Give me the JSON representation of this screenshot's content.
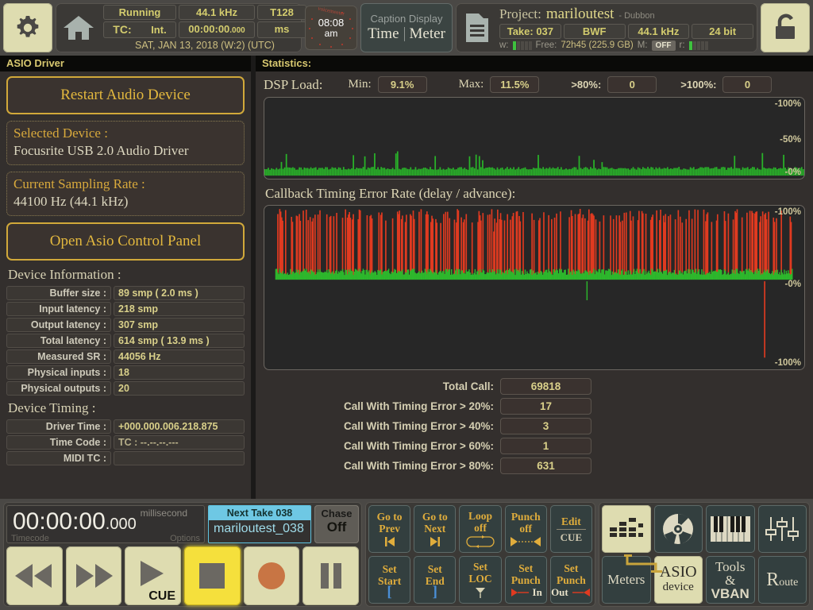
{
  "header": {
    "settings_icon": "gear-icon",
    "home_icon": "home-icon",
    "status": {
      "running": "Running",
      "samplerate": "44.1 kHz",
      "buffer": "T128",
      "tc_label": "TC:",
      "tc_source": "Int.",
      "timecode": "00:00:00",
      "timecode_ms": ".000",
      "units": "ms",
      "date": "SAT, JAN 13, 2018 (W:2) (UTC)"
    },
    "clock": {
      "time": "08:08",
      "ampm": "am",
      "brand": "voicemeeter"
    },
    "caption": {
      "title": "Caption Display",
      "opt_time": "Time",
      "opt_meter": "Meter"
    },
    "project": {
      "folder_icon": "folder-icon",
      "label": "Project:",
      "name": "mariloutest",
      "author": "- Dubbon",
      "take": "Take: 037",
      "format": "BWF",
      "samplerate": "44.1 kHz",
      "bitdepth": "24 bit",
      "write_label": "w:",
      "free_label": "Free:",
      "free_value": "72h45 (225.9 GB)",
      "monitor_label": "M:",
      "monitor_state": "OFF",
      "read_label": "r:",
      "write_level": 1,
      "read_level": 1
    },
    "lock_icon": "unlock-icon"
  },
  "left_panel": {
    "title": "ASIO Driver",
    "restart_button": "Restart Audio Device",
    "selected_device": {
      "label": "Selected Device :",
      "value": "Focusrite USB 2.0 Audio Driver"
    },
    "sampling_rate": {
      "label": "Current Sampling Rate :",
      "value": "44100 Hz (44.1 kHz)"
    },
    "control_panel_button": "Open Asio Control Panel",
    "device_info_title": "Device Information :",
    "device_info": [
      {
        "key": "Buffer size :",
        "value": "89 smp ( 2.0 ms )"
      },
      {
        "key": "Input latency :",
        "value": "218 smp"
      },
      {
        "key": "Output latency :",
        "value": "307 smp"
      },
      {
        "key": "Total latency :",
        "value": "614 smp ( 13.9 ms )"
      },
      {
        "key": "Measured SR :",
        "value": "44056 Hz"
      },
      {
        "key": "Physical inputs :",
        "value": "18"
      },
      {
        "key": "Physical outputs :",
        "value": "20"
      }
    ],
    "device_timing_title": "Device Timing :",
    "device_timing": [
      {
        "key": "Driver Time :",
        "value": "+000.000.006.218.875"
      },
      {
        "key": "Time Code :",
        "value": "TC : --.--.--.---"
      },
      {
        "key": "MIDI TC :",
        "value": ""
      }
    ]
  },
  "right_panel": {
    "title": "Statistics:",
    "dsp": {
      "label": "DSP Load:",
      "min_label": "Min:",
      "min_value": "9.1%",
      "max_label": "Max:",
      "max_value": "11.5%",
      "over80_label": ">80%:",
      "over80_value": "0",
      "over100_label": ">100%:",
      "over100_value": "0",
      "axis_top": "-100%",
      "axis_mid": "-50%",
      "axis_bottom": "-0%"
    },
    "callback": {
      "title": "Callback Timing Error Rate (delay / advance):",
      "axis_top": "-100%",
      "axis_mid": "-0%",
      "axis_bottom": "-100%"
    },
    "totals": [
      {
        "label": "Total Call:",
        "value": "69818"
      },
      {
        "label": "Call With Timing Error > 20%:",
        "value": "17"
      },
      {
        "label": "Call With Timing Error > 40%:",
        "value": "3"
      },
      {
        "label": "Call With Timing Error > 60%:",
        "value": "1"
      },
      {
        "label": "Call With Timing Error > 80%:",
        "value": "631"
      }
    ]
  },
  "chart_data": [
    {
      "type": "area",
      "title": "DSP Load",
      "ylabel": "%",
      "ylim": [
        0,
        100
      ],
      "yticks": [
        0,
        50,
        100
      ],
      "ytick_labels": [
        "-0%",
        "-50%",
        "-100%"
      ],
      "grid": false,
      "series": [
        {
          "name": "dsp-load",
          "color": "#29b329",
          "mean": 9.5,
          "min": 9.1,
          "max": 11.5
        }
      ]
    },
    {
      "type": "line",
      "title": "Callback Timing Error Rate (delay / advance)",
      "ylabel": "%",
      "ylim": [
        -100,
        100
      ],
      "yticks": [
        -100,
        0,
        100
      ],
      "ytick_labels": [
        "-100%",
        "-0%",
        "-100%"
      ],
      "grid": false,
      "series": [
        {
          "name": "delay",
          "color": "#e03a20",
          "note": "dense near-full-scale positive spikes"
        },
        {
          "name": "advance",
          "color": "#2cb82c",
          "note": "low-amplitude band around zero"
        }
      ]
    }
  ],
  "bottom": {
    "timecode": {
      "value": "00:00:00",
      "ms": ".000",
      "unit_label": "millisecond",
      "name_label": "Timecode",
      "options_label": "Options"
    },
    "next_take": {
      "header": "Next Take 038",
      "filename": "mariloutest_038"
    },
    "chase": {
      "label": "Chase",
      "state": "Off"
    },
    "transport": [
      {
        "name": "rewind-button",
        "icon": "rewind-icon",
        "label": ""
      },
      {
        "name": "fast-forward-button",
        "icon": "fast-forward-icon",
        "label": ""
      },
      {
        "name": "play-button",
        "icon": "play-icon",
        "label": "CUE"
      },
      {
        "name": "stop-button",
        "icon": "stop-icon",
        "label": ""
      },
      {
        "name": "record-button",
        "icon": "record-icon",
        "label": ""
      },
      {
        "name": "pause-button",
        "icon": "pause-icon",
        "label": ""
      }
    ],
    "nav_buttons": [
      {
        "l1": "Go to",
        "l2": "Prev",
        "icon": "skip-back-icon"
      },
      {
        "l1": "Go to",
        "l2": "Next",
        "icon": "skip-forward-icon"
      },
      {
        "l1": "Loop",
        "l2": "off",
        "icon": "loop-icon"
      },
      {
        "l1": "Punch",
        "l2": "off",
        "icon": "punch-icon"
      },
      {
        "l1": "Edit",
        "l2": "CUE",
        "icon": "edit-icon"
      },
      {
        "l1": "Set",
        "l2": "Start",
        "icon": "bracket-open-icon"
      },
      {
        "l1": "Set",
        "l2": "End",
        "icon": "bracket-close-icon"
      },
      {
        "l1": "Set",
        "l2": "LOC",
        "icon": "locator-icon"
      },
      {
        "l1": "Set",
        "l2": "Punch",
        "icon": "punch-in-icon",
        "l3": "In"
      },
      {
        "l1": "Set",
        "l2": "Punch",
        "icon": "punch-out-icon",
        "l3": "Out"
      }
    ],
    "modules": [
      {
        "name": "meters-icon-button",
        "icon": "equalizer-icon",
        "selected": true
      },
      {
        "name": "disc-icon-button",
        "icon": "disc-icon",
        "selected": false
      },
      {
        "name": "keyboard-icon-button",
        "icon": "piano-keyboard-icon",
        "selected": false
      },
      {
        "name": "faders-icon-button",
        "icon": "sliders-icon",
        "selected": false
      },
      {
        "name": "meters-button",
        "label": "Meters",
        "selected": false
      },
      {
        "name": "asio-device-button",
        "label": "ASIO",
        "label2": "device",
        "selected": true
      },
      {
        "name": "tools-vban-button",
        "label": "Tools",
        "label2": "&",
        "label3": "VBAN",
        "selected": false
      },
      {
        "name": "route-button",
        "label": "R",
        "label2": "oute",
        "selected": false
      }
    ]
  },
  "colors": {
    "accent_gold": "#e3b83e",
    "text_olive": "#d3cc6e",
    "graph_green": "#29b329",
    "graph_red": "#e03a20",
    "cyan": "#6ec8e4",
    "cream": "#dedcb0"
  }
}
